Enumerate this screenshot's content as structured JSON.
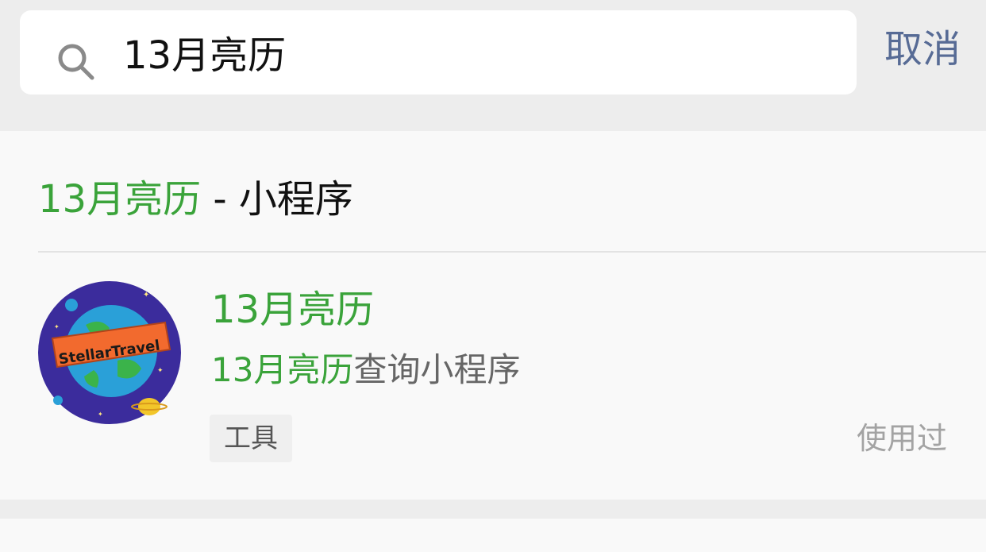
{
  "search": {
    "value": "13月亮历",
    "icon": "search-icon",
    "cancel_label": "取消"
  },
  "section": {
    "highlight": "13月亮历",
    "suffix": " - 小程序"
  },
  "result": {
    "avatar_text": "StellarTravel",
    "title": "13月亮历",
    "desc_highlight": "13月亮历",
    "desc_rest": "查询小程序",
    "tag": "工具",
    "status": "使用过"
  },
  "colors": {
    "highlight": "#3aa33a",
    "cancel": "#576b95",
    "background": "#ededed",
    "card": "#f9f9f9"
  }
}
